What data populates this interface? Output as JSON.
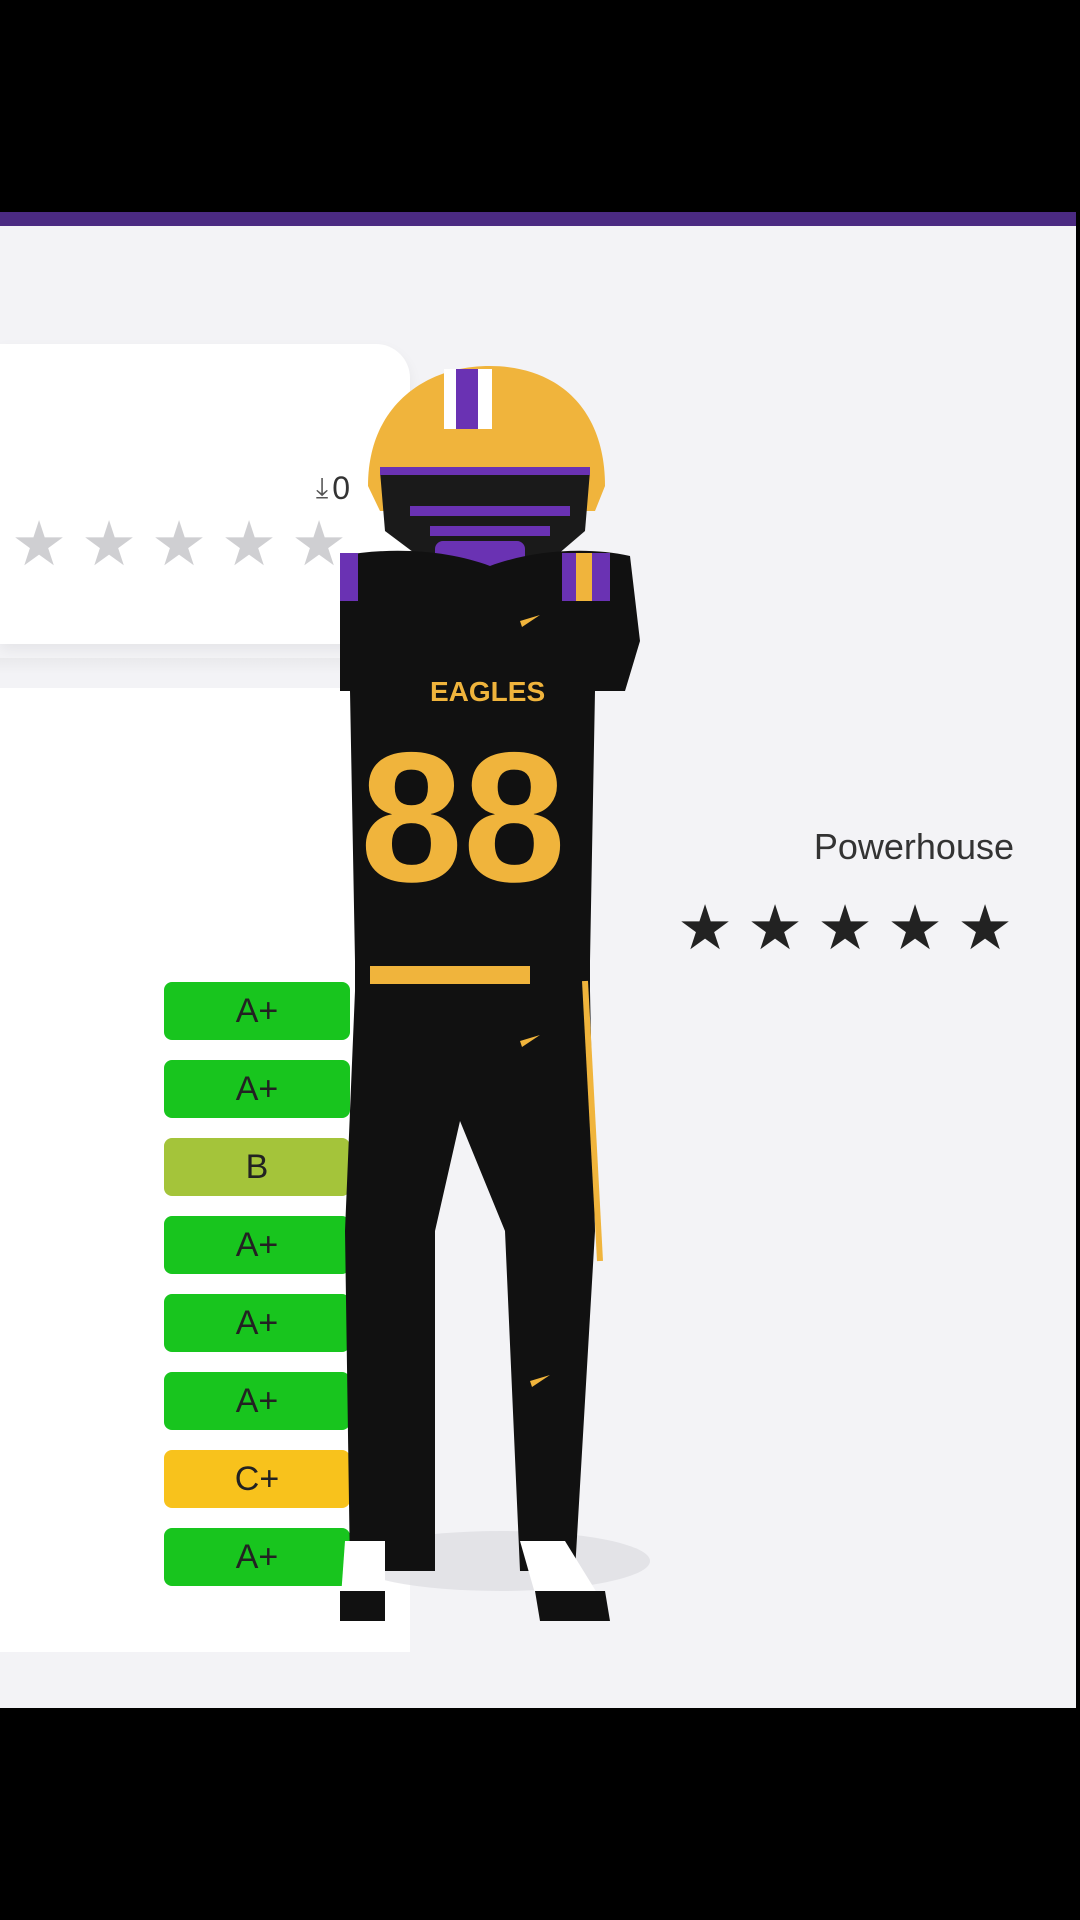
{
  "top_card": {
    "download_count": "0",
    "stars": {
      "filled": 0,
      "total": 5
    }
  },
  "bottom_card": {
    "program_label": "Powerhouse",
    "stars": {
      "filled": 5,
      "total": 5
    },
    "grades": [
      {
        "value": "A+",
        "color": "#18c51e"
      },
      {
        "value": "A+",
        "color": "#18c51e"
      },
      {
        "value": "B",
        "color": "#a4c43a"
      },
      {
        "value": "A+",
        "color": "#18c51e"
      },
      {
        "value": "A+",
        "color": "#18c51e"
      },
      {
        "value": "A+",
        "color": "#18c51e"
      },
      {
        "value": "C+",
        "color": "#f8c21c"
      },
      {
        "value": "A+",
        "color": "#18c51e"
      }
    ]
  },
  "player": {
    "team_text": "EAGLES",
    "jersey_number": "88",
    "colors": {
      "primary": "#111111",
      "gold": "#f0b43c",
      "purple": "#6a32b3",
      "white": "#ffffff"
    }
  },
  "theme": {
    "accent": "#4b2a82",
    "background": "#f3f3f6"
  },
  "icons": {
    "download": "download-icon",
    "star": "star-icon"
  }
}
